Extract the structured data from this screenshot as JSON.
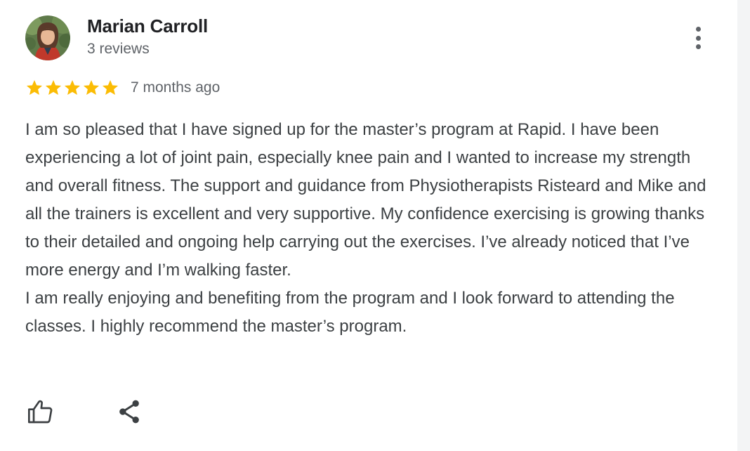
{
  "review": {
    "author_name": "Marian Carroll",
    "review_count": "3 reviews",
    "rating": 5,
    "max_rating": 5,
    "time_ago": "7 months ago",
    "paragraphs": [
      "I am so pleased that I have signed up for the master’s program at Rapid. I have been experiencing a lot of joint pain, especially knee pain and I wanted to increase my strength and overall fitness. The support and guidance from Physiotherapists Risteard and Mike and all the trainers is excellent and very supportive. My confidence exercising is growing thanks to their detailed and ongoing help carrying out the exercises. I’ve already noticed that I’ve more energy and I’m walking faster.",
      "I am really enjoying and benefiting from the program and I look forward to attending the classes. I highly recommend the master’s program."
    ]
  },
  "icons": {
    "more": "more-vert-icon",
    "star": "star-icon",
    "like": "thumbs-up-icon",
    "share": "share-icon"
  },
  "colors": {
    "star": "#fbbc04",
    "name": "#202124",
    "secondary": "#5f6368",
    "body": "#3c4043"
  }
}
